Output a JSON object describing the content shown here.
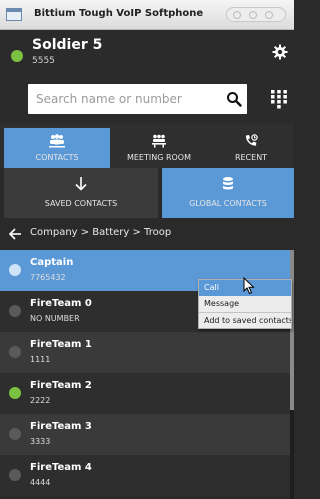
{
  "window": {
    "title": "Bittium Tough VoIP Softphone",
    "app_icon": "window-app-icon"
  },
  "profile": {
    "name": "Soldier 5",
    "number": "5555",
    "status_color": "#7cc242"
  },
  "search": {
    "placeholder": "Search name or number",
    "value": ""
  },
  "tabs": [
    {
      "label": "CONTACTS",
      "icon": "contacts-icon",
      "active": true
    },
    {
      "label": "MEETING ROOM",
      "icon": "meeting-room-icon",
      "active": false
    },
    {
      "label": "RECENT",
      "icon": "recent-calls-icon",
      "active": false
    }
  ],
  "subtabs": [
    {
      "label": "SAVED CONTACTS",
      "icon": "download-arrow-icon",
      "active": false
    },
    {
      "label": "GLOBAL CONTACTS",
      "icon": "database-icon",
      "active": true
    }
  ],
  "breadcrumb": {
    "path": "Company > Battery > Troop"
  },
  "contacts": [
    {
      "name": "Captain",
      "number": "7765432",
      "status": "selected"
    },
    {
      "name": "FireTeam 0",
      "number": "NO NUMBER",
      "status": "offline"
    },
    {
      "name": "FireTeam 1",
      "number": "1111",
      "status": "offline"
    },
    {
      "name": "FireTeam 2",
      "number": "2222",
      "status": "online"
    },
    {
      "name": "FireTeam 3",
      "number": "3333",
      "status": "offline"
    },
    {
      "name": "FireTeam 4",
      "number": "4444",
      "status": "offline"
    }
  ],
  "context_menu": {
    "items": [
      "Call",
      "Message",
      "Add to saved contacts"
    ],
    "highlighted": "Call"
  },
  "colors": {
    "accent": "#5b98d6",
    "online": "#7cc242",
    "offline": "#5a5a5a",
    "background": "#2a2a2a"
  }
}
